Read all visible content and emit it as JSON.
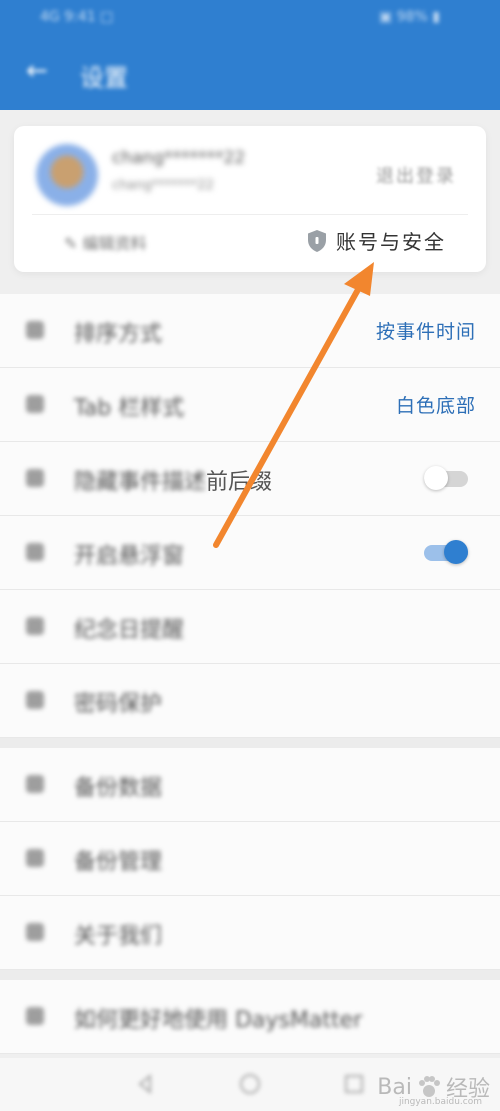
{
  "status_bar": {
    "left": "4G 9:41 □",
    "right": "▣ 98% ▮"
  },
  "app_bar": {
    "title": "设置",
    "back_icon": "arrow-left-icon"
  },
  "account": {
    "user_name": "chang*******22",
    "user_sub": "chang*******22",
    "logout_label": "退出登录",
    "edit_profile_label": "编辑资料",
    "security_label": "账号与安全"
  },
  "settings": {
    "row_sort": {
      "label": "排序方式",
      "value": "按事件时间"
    },
    "row_tab_style": {
      "label": "Tab 栏样式",
      "value": "白色底部"
    },
    "row_affix": {
      "label_blur": "隐藏事件描述",
      "label_clear": "前后缀",
      "toggle": "off"
    },
    "row_floating": {
      "label": "开启悬浮窗",
      "toggle": "on"
    },
    "row_anniversary": {
      "label": "纪念日提醒"
    },
    "row_lock": {
      "label": "密码保护"
    },
    "row_backup": {
      "label": "备份数据"
    },
    "row_backup_manage": {
      "label": "备份管理"
    },
    "row_about": {
      "label": "关于我们"
    },
    "row_tip": {
      "label": "如何更好地使用 DaysMatter"
    }
  },
  "watermark": {
    "brand": "Bai",
    "brand2": "经验",
    "url": "jingyan.baidu.com"
  },
  "colors": {
    "primary": "#2f7fd0",
    "value_text": "#2d6fb7",
    "arrow": "#f2862e"
  }
}
